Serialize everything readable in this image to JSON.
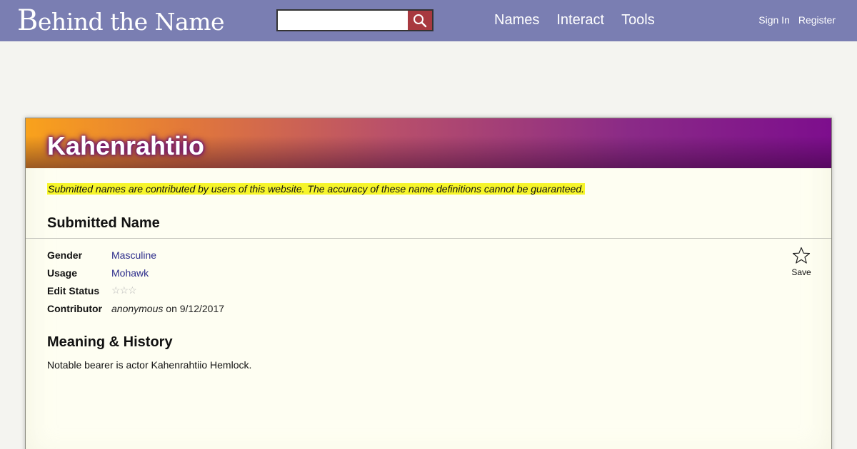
{
  "header": {
    "logo_first": "B",
    "logo_rest": "ehind the Name",
    "search": {
      "value": "",
      "placeholder": ""
    },
    "search_icon": "magnifier-icon",
    "nav": [
      "Names",
      "Interact",
      "Tools"
    ],
    "account": {
      "sign_in": "Sign In",
      "register": "Register"
    },
    "colors": {
      "bar": "#7a7eb2",
      "search_button": "#a8393f"
    }
  },
  "name_page": {
    "title": "Kahenrahtiio",
    "disclaimer": "Submitted names are contributed by users of this website. The accuracy of these name definitions cannot be guaranteed.",
    "section_heading": "Submitted Name",
    "info": {
      "gender_label": "Gender",
      "gender_value": "Masculine",
      "usage_label": "Usage",
      "usage_value": "Mohawk",
      "edit_status_label": "Edit Status",
      "edit_status_stars": "☆☆☆",
      "contributor_label": "Contributor",
      "contributor_name": "anonymous",
      "contributor_date": "on 9/12/2017"
    },
    "save": {
      "icon": "star-outline-icon",
      "label": "Save"
    },
    "meaning_heading": "Meaning & History",
    "meaning_text": "Notable bearer is actor Kahenrahtiio Hemlock.",
    "colors": {
      "banner_start": "#f9a21c",
      "banner_end": "#7d0e8d",
      "highlight": "#f6f52a"
    }
  }
}
